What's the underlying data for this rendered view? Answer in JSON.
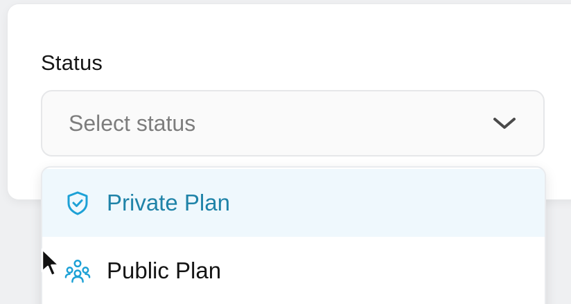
{
  "form": {
    "status_label": "Status",
    "status_select": {
      "placeholder": "Select status"
    }
  },
  "dropdown": {
    "options": [
      {
        "label": "Private Plan",
        "icon": "shield-check-icon",
        "highlighted": true
      },
      {
        "label": "Public Plan",
        "icon": "users-group-icon",
        "highlighted": false
      }
    ]
  },
  "colors": {
    "accent": "#1f83a8",
    "icon": "#1da1d6",
    "highlight_bg": "#eff8fd",
    "placeholder": "#7d7d7d"
  }
}
